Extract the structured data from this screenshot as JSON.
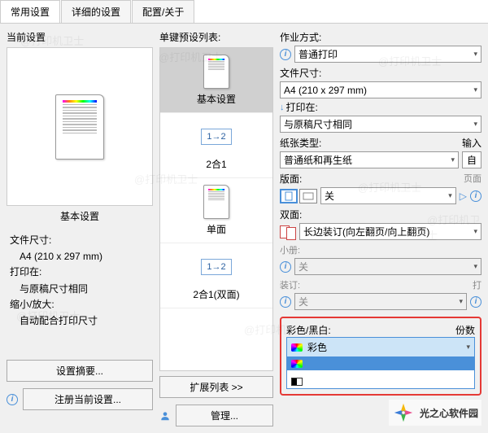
{
  "tabs": {
    "t1": "常用设置",
    "t2": "详细的设置",
    "t3": "配置/关于"
  },
  "left": {
    "current_settings": "当前设置",
    "preview_caption": "基本设置",
    "file_size_label": "文件尺寸:",
    "file_size_value": "A4 (210 x 297 mm)",
    "print_on_label": "打印在:",
    "print_on_value": "与原稿尺寸相同",
    "scale_label": "缩小/放大:",
    "scale_value": "自动配合打印尺寸",
    "summary_btn": "设置摘要...",
    "register_btn": "注册当前设置..."
  },
  "presets": {
    "header": "单键预设列表:",
    "items": {
      "p1": "基本设置",
      "p2": "2合1",
      "p3": "单面",
      "p4": "2合1(双面)"
    },
    "nin1": "1→2",
    "expand_btn": "扩展列表 >>",
    "manage_btn": "管理..."
  },
  "right": {
    "job_label": "作业方式:",
    "job_value": "普通打印",
    "size_label": "文件尺寸:",
    "size_value": "A4 (210 x 297 mm)",
    "printon_label": "打印在:",
    "printon_value": "与原稿尺寸相同",
    "paper_label": "纸张类型:",
    "paper_value": "普通纸和再生纸",
    "input_label": "输入",
    "input_value": "自",
    "layout_label": "版面:",
    "layout_value": "关",
    "page_label": "页面",
    "duplex_label": "双面:",
    "duplex_value": "长边装订(向左翻页/向上翻页)",
    "booklet_label": "小册:",
    "booklet_value": "关",
    "staple_label": "装订:",
    "staple_value": "关",
    "punch_label": "打",
    "color_label": "彩色/黑白:",
    "color_value": "彩色",
    "copies_label": "份数"
  },
  "brand": "光之心软件园",
  "watermark": "@打印机卫士"
}
